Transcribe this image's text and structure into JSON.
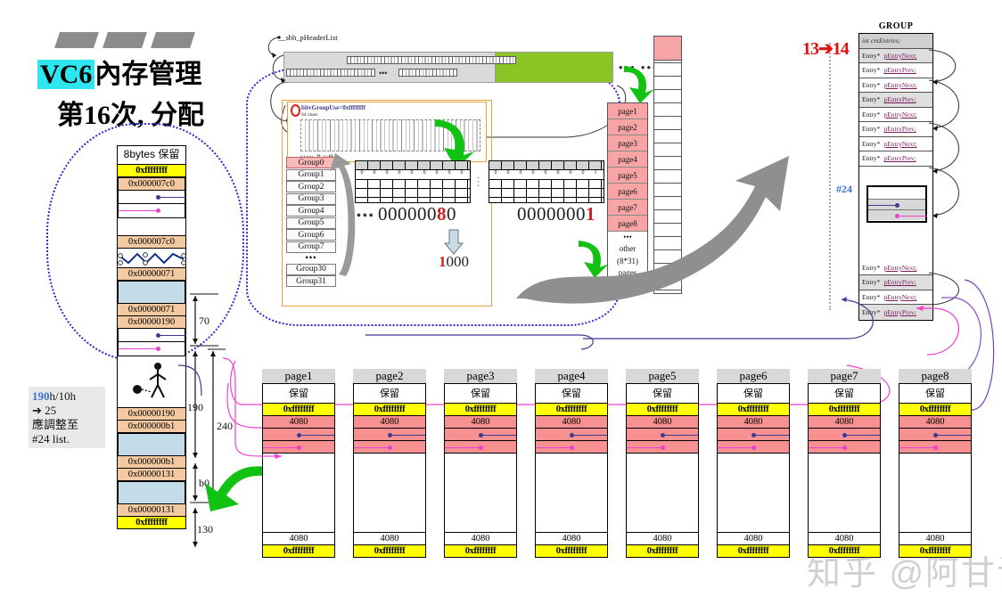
{
  "title": {
    "badge": "VC6",
    "line1_rest": "內存管理",
    "line2": "第16次, 分配"
  },
  "left_note": {
    "l1_highlight": "190",
    "l1_rest": "h/10h",
    "l2": "➔ 25",
    "l3": "應調整至",
    "l4": "#24 list."
  },
  "memory_column": {
    "header": "8bytes 保留",
    "rows": [
      {
        "name": "guard-top",
        "text": "0xffffffff",
        "style": "yellow"
      },
      {
        "name": "size-7c0-top",
        "text": "0x000007c0",
        "style": "tan"
      },
      {
        "name": "ptr-next-row",
        "text": "",
        "style": "ptr-navy"
      },
      {
        "name": "ptr-prev-row",
        "text": "",
        "style": "ptr-magenta"
      },
      {
        "name": "free-gap",
        "text": "",
        "style": "white"
      },
      {
        "name": "size-7c0-bottom",
        "text": "0x000007c0",
        "style": "tan"
      },
      {
        "name": "squiggle-break",
        "text": "",
        "style": "squiggle"
      },
      {
        "name": "size-71-top",
        "text": "0x00000071",
        "style": "tan"
      },
      {
        "name": "used-block-70",
        "text": "",
        "style": "blue"
      },
      {
        "name": "size-71-bottom",
        "text": "0x00000071",
        "style": "tan"
      },
      {
        "name": "size-190-top",
        "text": "0x00000190",
        "style": "tan"
      },
      {
        "name": "ptr-next-row-2",
        "text": "",
        "style": "ptr-navy"
      },
      {
        "name": "ptr-prev-row-2",
        "text": "",
        "style": "ptr-magenta"
      },
      {
        "name": "free-gap-2",
        "text": "",
        "style": "white-tall"
      },
      {
        "name": "size-190-bottom",
        "text": "0x00000190",
        "style": "tan"
      },
      {
        "name": "size-b1-top",
        "text": "0x000000b1",
        "style": "tan"
      },
      {
        "name": "used-block-b0",
        "text": "",
        "style": "blue"
      },
      {
        "name": "size-b1-bottom",
        "text": "0x000000b1",
        "style": "tan"
      },
      {
        "name": "size-131-top",
        "text": "0x00000131",
        "style": "tan"
      },
      {
        "name": "used-block-130",
        "text": "",
        "style": "blue"
      },
      {
        "name": "size-131-bottom",
        "text": "0x00000131",
        "style": "tan"
      },
      {
        "name": "guard-bottom",
        "text": "0xffffffff",
        "style": "yellow"
      }
    ],
    "measures": [
      "70",
      "190",
      "240",
      "b0",
      "130"
    ]
  },
  "header_list": {
    "label": "__sbh_pHeaderList",
    "ellipsis": "•••  •••"
  },
  "orange_box": {
    "title": "bitvGroupUse=0xffffffff",
    "subtitle": "64 chars",
    "footer": "64 bits, 共 32 組"
  },
  "group_list": {
    "items": [
      "Group0",
      "Group1",
      "Group2",
      "Group3",
      "Group4",
      "Group5",
      "Group6",
      "Group7",
      "•••",
      "Group30",
      "Group31"
    ],
    "selected": "Group0"
  },
  "bitmap": {
    "left_hex": "0000008",
    "left_hex_hi": "0",
    "right_hex": "0000000",
    "right_hex_hi": "1",
    "left_hex_prefix": "000000",
    "left_hex_red": "8",
    "left_hex_suffix": "0",
    "right_hex_prefix": "0000000",
    "right_hex_red": "1",
    "right_hex_suffix": "",
    "result_red": "1",
    "result_rest": "000",
    "dots": "•••"
  },
  "page_column": {
    "pages": [
      "page1",
      "page2",
      "page3",
      "page4",
      "page5",
      "page6",
      "page7",
      "page8"
    ],
    "other_l1": "•••",
    "other_l2": "other",
    "other_l3": "(8*31)",
    "other_l4": "pages"
  },
  "group_table": {
    "title": "GROUP",
    "head": "int  cntEntries;",
    "rows": [
      {
        "type": "Entry*",
        "field": "pEntryNext;"
      },
      {
        "type": "Entry*",
        "field": "pEntryPrev;"
      },
      {
        "type": "Entry*",
        "field": "pEntryNext;"
      },
      {
        "type": "Entry*",
        "field": "pEntryPrev;"
      },
      {
        "type": "Entry*",
        "field": "pEntryNext;"
      },
      {
        "type": "Entry*",
        "field": "pEntryPrev;"
      },
      {
        "type": "Entry*",
        "field": "pEntryNext;"
      },
      {
        "type": "Entry*",
        "field": "pEntryPrev;"
      }
    ],
    "rows_lower": [
      {
        "type": "Entry*",
        "field": "pEntryNext;"
      },
      {
        "type": "Entry*",
        "field": "pEntryPrev;"
      },
      {
        "type": "Entry*",
        "field": "pEntryNext;"
      },
      {
        "type": "Entry*",
        "field": "pEntryPrev;"
      }
    ],
    "counter_label": "13➔14",
    "selected_index_label": "#24"
  },
  "pages": [
    {
      "label": "page1",
      "reserved": "保留",
      "guard": "0xffffffff",
      "size": "4080",
      "tail_size": "4080",
      "tail_guard": "0xffffffff"
    },
    {
      "label": "page2",
      "reserved": "保留",
      "guard": "0xffffffff",
      "size": "4080",
      "tail_size": "4080",
      "tail_guard": "0xffffffff"
    },
    {
      "label": "page3",
      "reserved": "保留",
      "guard": "0xffffffff",
      "size": "4080",
      "tail_size": "4080",
      "tail_guard": "0xffffffff"
    },
    {
      "label": "page4",
      "reserved": "保留",
      "guard": "0xffffffff",
      "size": "4080",
      "tail_size": "4080",
      "tail_guard": "0xffffffff"
    },
    {
      "label": "page5",
      "reserved": "保留",
      "guard": "0xffffffff",
      "size": "4080",
      "tail_size": "4080",
      "tail_guard": "0xffffffff"
    },
    {
      "label": "page6",
      "reserved": "保留",
      "guard": "0xffffffff",
      "size": "4080",
      "tail_size": "4080",
      "tail_guard": "0xffffffff"
    },
    {
      "label": "page7",
      "reserved": "保留",
      "guard": "0xffffffff",
      "size": "4080",
      "tail_size": "4080",
      "tail_guard": "0xffffffff"
    },
    {
      "label": "page8",
      "reserved": "保留",
      "guard": "0xffffffff",
      "size": "4080",
      "tail_size": "4080",
      "tail_guard": "0xffffffff"
    }
  ],
  "watermark": "知乎 @阿甘试",
  "colors": {
    "accent_cyan": "#2ee6ef",
    "yellow": "#ffff00",
    "tan": "#f2c9a0",
    "blue_block": "#c3dce8",
    "pink": "#f79191",
    "green": "#8cc426",
    "red": "#cf2020",
    "navy": "#3b3b8f",
    "magenta": "#ef3fd0"
  }
}
